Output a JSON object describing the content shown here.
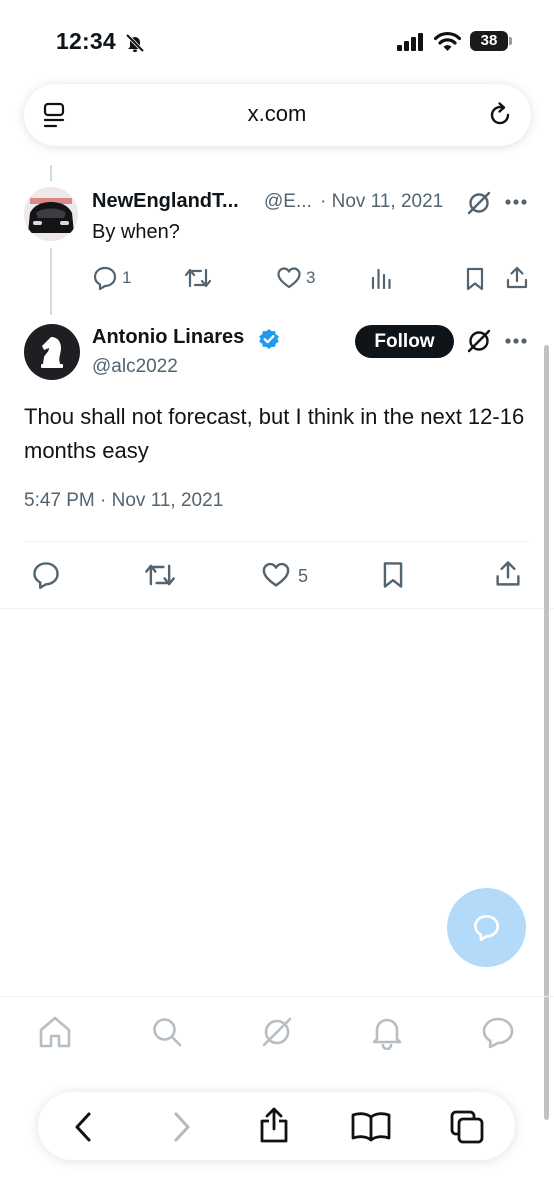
{
  "status_bar": {
    "time": "12:34",
    "battery": "38"
  },
  "browser": {
    "url": "x.com"
  },
  "reply_tweet": {
    "display_name": "NewEnglandT...",
    "handle": "@E...",
    "date": "· Nov 11, 2021",
    "text": "By when?",
    "replies": "1",
    "likes": "3"
  },
  "main_tweet": {
    "display_name": "Antonio Linares",
    "handle": "@alc2022",
    "follow_label": "Follow",
    "text": "Thou shall not forecast, but I think in the next 12-16 months easy",
    "timestamp": "5:47 PM · Nov 11, 2021",
    "likes": "5"
  },
  "colors": {
    "accent": "#1d9bf0",
    "fab": "#b3dbf9",
    "text": "#0f1419",
    "muted": "#536471"
  },
  "icons": {
    "status": [
      "bell-slash-icon",
      "signal-icon",
      "wifi-icon",
      "battery-icon"
    ],
    "tweet_actions": [
      "reply-icon",
      "retweet-icon",
      "like-icon",
      "views-icon",
      "bookmark-icon",
      "share-icon"
    ],
    "tab_bar": [
      "home-icon",
      "search-icon",
      "grok-icon",
      "notifications-icon",
      "messages-icon"
    ],
    "safari_toolbar": [
      "back-icon",
      "forward-icon",
      "share-icon",
      "bookmarks-icon",
      "tabs-icon"
    ]
  }
}
